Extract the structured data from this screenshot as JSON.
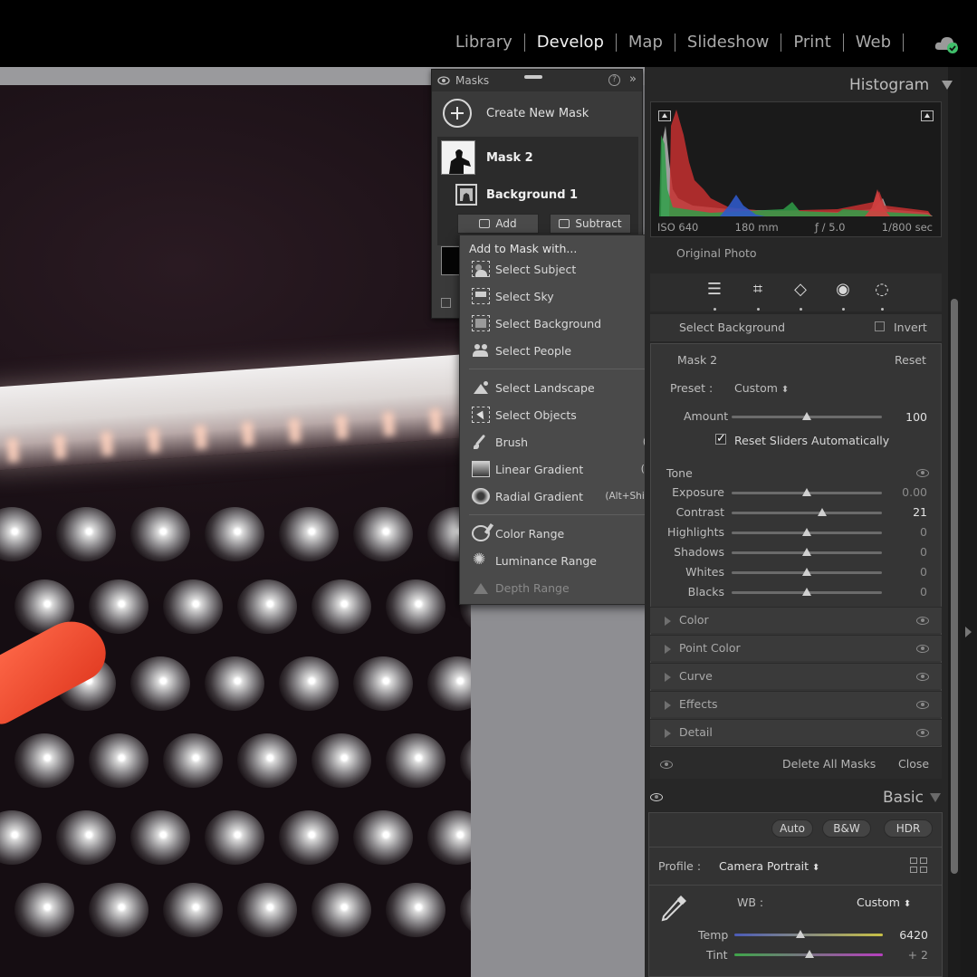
{
  "top_nav": {
    "modules": [
      "Library",
      "Develop",
      "Map",
      "Slideshow",
      "Print",
      "Web"
    ],
    "active": "Develop"
  },
  "masks_panel": {
    "title": "Masks",
    "create_label": "Create New Mask",
    "mask_name": "Mask 2",
    "component_name": "Background 1",
    "add_label": "Add",
    "subtract_label": "Subtract"
  },
  "add_menu": {
    "title": "Add to Mask with...",
    "items": [
      {
        "label": "Select Subject",
        "shortcut": "",
        "icon": "select-subject-icon"
      },
      {
        "label": "Select Sky",
        "shortcut": "",
        "icon": "select-sky-icon"
      },
      {
        "label": "Select Background",
        "shortcut": "",
        "icon": "select-background-icon"
      },
      {
        "label": "Select People",
        "shortcut": "",
        "icon": "select-people-icon"
      },
      {
        "label": "Select Landscape",
        "shortcut": "",
        "icon": "select-landscape-icon"
      },
      {
        "label": "Select Objects",
        "shortcut": "",
        "icon": "select-objects-icon"
      },
      {
        "label": "Brush",
        "shortcut": "(Alt+K)",
        "icon": "brush-icon"
      },
      {
        "label": "Linear Gradient",
        "shortcut": "(Alt+M)",
        "icon": "linear-gradient-icon"
      },
      {
        "label": "Radial Gradient",
        "shortcut": "(Alt+Shift + M)",
        "icon": "radial-gradient-icon"
      },
      {
        "label": "Color Range",
        "shortcut": "",
        "icon": "color-range-icon"
      },
      {
        "label": "Luminance Range",
        "shortcut": "",
        "icon": "luminance-range-icon"
      },
      {
        "label": "Depth Range",
        "shortcut": "",
        "icon": "depth-range-icon",
        "disabled": true
      }
    ]
  },
  "histogram": {
    "title": "Histogram",
    "iso": "ISO 640",
    "focal": "180 mm",
    "aperture": "ƒ / 5.0",
    "shutter": "1/800 sec",
    "original_photo": "Original Photo"
  },
  "mask_settings": {
    "component": "Select Background",
    "invert_label": "Invert",
    "mask_name": "Mask 2",
    "reset_label": "Reset",
    "preset_label": "Preset :",
    "preset_value": "Custom",
    "amount_label": "Amount",
    "amount_value": "100",
    "reset_sliders_label": "Reset Sliders Automatically",
    "tone_label": "Tone",
    "sliders": [
      {
        "label": "Exposure",
        "value": "0.00",
        "pos": 0.5
      },
      {
        "label": "Contrast",
        "value": "21",
        "pos": 0.6
      },
      {
        "label": "Highlights",
        "value": "0",
        "pos": 0.5
      },
      {
        "label": "Shadows",
        "value": "0",
        "pos": 0.5
      },
      {
        "label": "Whites",
        "value": "0",
        "pos": 0.5
      },
      {
        "label": "Blacks",
        "value": "0",
        "pos": 0.5
      }
    ],
    "sections": [
      "Color",
      "Point Color",
      "Curve",
      "Effects",
      "Detail"
    ],
    "delete_all_label": "Delete All Masks",
    "close_label": "Close"
  },
  "basic": {
    "title": "Basic",
    "auto_label": "Auto",
    "bw_label": "B&W",
    "hdr_label": "HDR",
    "profile_label": "Profile :",
    "profile_value": "Camera Portrait",
    "wb_label": "WB :",
    "wb_value": "Custom",
    "temp_label": "Temp",
    "temp_value": "6420",
    "tint_label": "Tint",
    "tint_value": "+ 2"
  },
  "colors": {
    "accent_green": "#3fbf6a",
    "panel_bg": "#272727"
  }
}
